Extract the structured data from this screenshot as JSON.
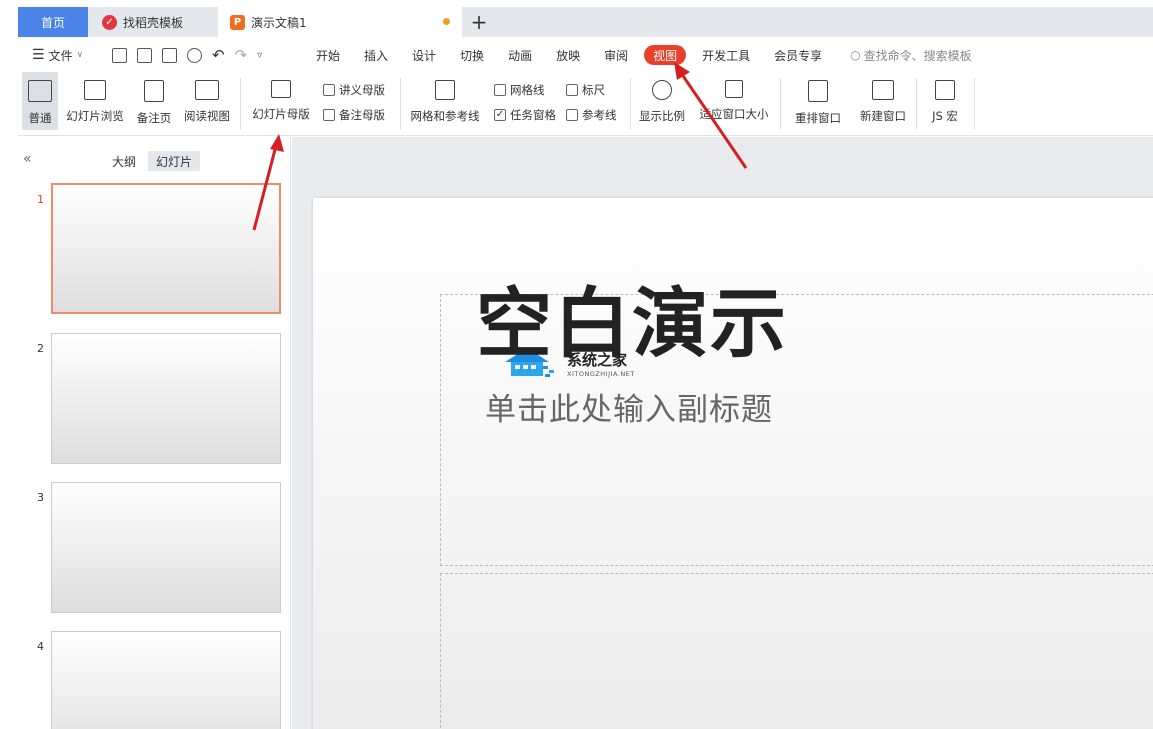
{
  "tabs": {
    "home": "首页",
    "daoke": "找稻壳模板",
    "doc": "演示文稿1",
    "new_tab": "+"
  },
  "menubar": {
    "file": "文件",
    "items": [
      "开始",
      "插入",
      "设计",
      "切换",
      "动画",
      "放映",
      "审阅",
      "视图",
      "开发工具",
      "会员专享"
    ],
    "active": "视图",
    "search_placeholder": "查找命令、搜索模板"
  },
  "ribbon": {
    "normal": "普通",
    "slide_browse": "幻灯片浏览",
    "notes_page": "备注页",
    "reading_view": "阅读视图",
    "slide_master": "幻灯片母版",
    "handout_master": "讲义母版",
    "notes_master": "备注母版",
    "grid_guides": "网格和参考线",
    "gridlines": "网格线",
    "ruler": "标尺",
    "task_pane": "任务窗格",
    "guides": "参考线",
    "zoom": "显示比例",
    "fit_window": "适应窗口大小",
    "arrange": "重排窗口",
    "new_window": "新建窗口",
    "js_macro": "JS 宏"
  },
  "left_panel": {
    "collapse": "«",
    "outline_tab": "大纲",
    "slides_tab": "幻灯片",
    "slide_numbers": [
      "1",
      "2",
      "3",
      "4"
    ]
  },
  "slide": {
    "title": "空白演示",
    "subtitle": "单击此处输入副标题",
    "logo_name": "系统之家",
    "logo_url": "XITONGZHIJIA.NET"
  },
  "colors": {
    "accent": "#4a84e8",
    "active_tab": "#e8412a",
    "arrow": "#d42020"
  }
}
